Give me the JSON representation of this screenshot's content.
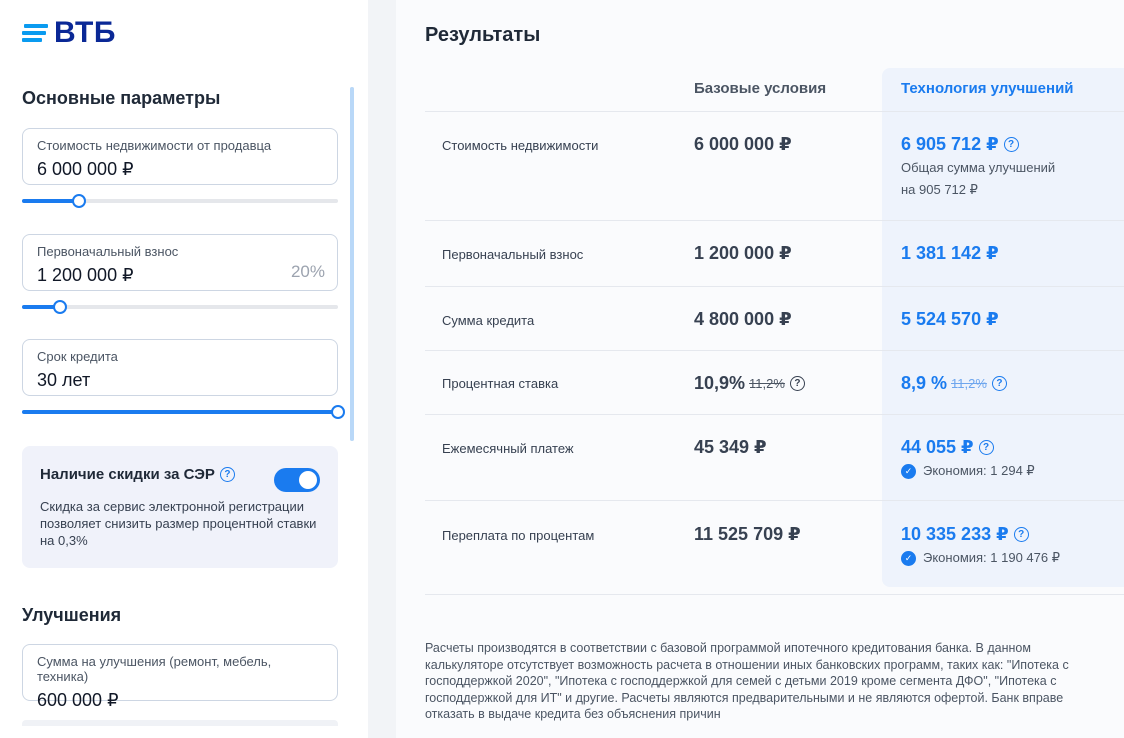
{
  "brand": {
    "logo_text": "ВТБ"
  },
  "params": {
    "section_title": "Основные параметры",
    "property_price": {
      "label": "Стоимость недвижимости от продавца",
      "value": "6 000 000 ₽",
      "slider_fraction": 0.18
    },
    "down_payment": {
      "label": "Первоначальный взнос",
      "value": "1 200 000 ₽",
      "percent": "20%",
      "slider_fraction": 0.12
    },
    "term": {
      "label": "Срок кредита",
      "value": "30 лет",
      "slider_fraction": 1.0
    },
    "discount": {
      "title": "Наличие скидки за СЭР",
      "enabled": true,
      "description": "Скидка за сервис электронной регистрации позволяет снизить размер процентной ставки на 0,3%"
    }
  },
  "improvements": {
    "section_title": "Улучшения",
    "amount": {
      "label": "Сумма на улучшения (ремонт, мебель, техника)",
      "value": "600 000 ₽"
    }
  },
  "results": {
    "title": "Результаты",
    "col_base": "Базовые условия",
    "col_tech": "Технология улучшений",
    "rows": [
      {
        "label": "Стоимость недвижимости",
        "base": "6 000 000 ₽",
        "tech": "6 905 712 ₽",
        "tech_note_1": "Общая сумма улучшений",
        "tech_note_2": "на 905 712 ₽"
      },
      {
        "label": "Первоначальный взнос",
        "base": "1 200 000 ₽",
        "tech": "1 381 142 ₽"
      },
      {
        "label": "Сумма кредита",
        "base": "4 800 000 ₽",
        "tech": "5 524 570 ₽"
      },
      {
        "label": "Процентная ставка",
        "base": "10,9%",
        "base_old": "11,2%",
        "tech": "8,9 %",
        "tech_old": "11,2%"
      },
      {
        "label": "Ежемесячный платеж",
        "base": "45 349 ₽",
        "tech": "44 055 ₽",
        "saving": "Экономия: 1 294 ₽"
      },
      {
        "label": "Переплата по процентам",
        "base": "11 525 709 ₽",
        "tech": "10 335 233 ₽",
        "saving": "Экономия: 1 190 476 ₽"
      }
    ],
    "disclaimer": "Расчеты производятся в соответствии с базовой программой ипотечного кредитования банка. В данном калькуляторе отсутствует возможность расчета в отношении иных банковских программ, таких как: \"Ипотека с господдержкой 2020\", \"Ипотека с господдержкой для семей с детьми 2019 кроме сегмента ДФО\", \"Ипотека с господдержкой для ИТ\" и другие. Расчеты являются предварительными и не являются офертой. Банк вправе отказать в выдаче кредита без объяснения причин"
  },
  "colors": {
    "accent": "#1a7bef",
    "brand": "#0a2896",
    "brand_light": "#0a9bf0"
  }
}
